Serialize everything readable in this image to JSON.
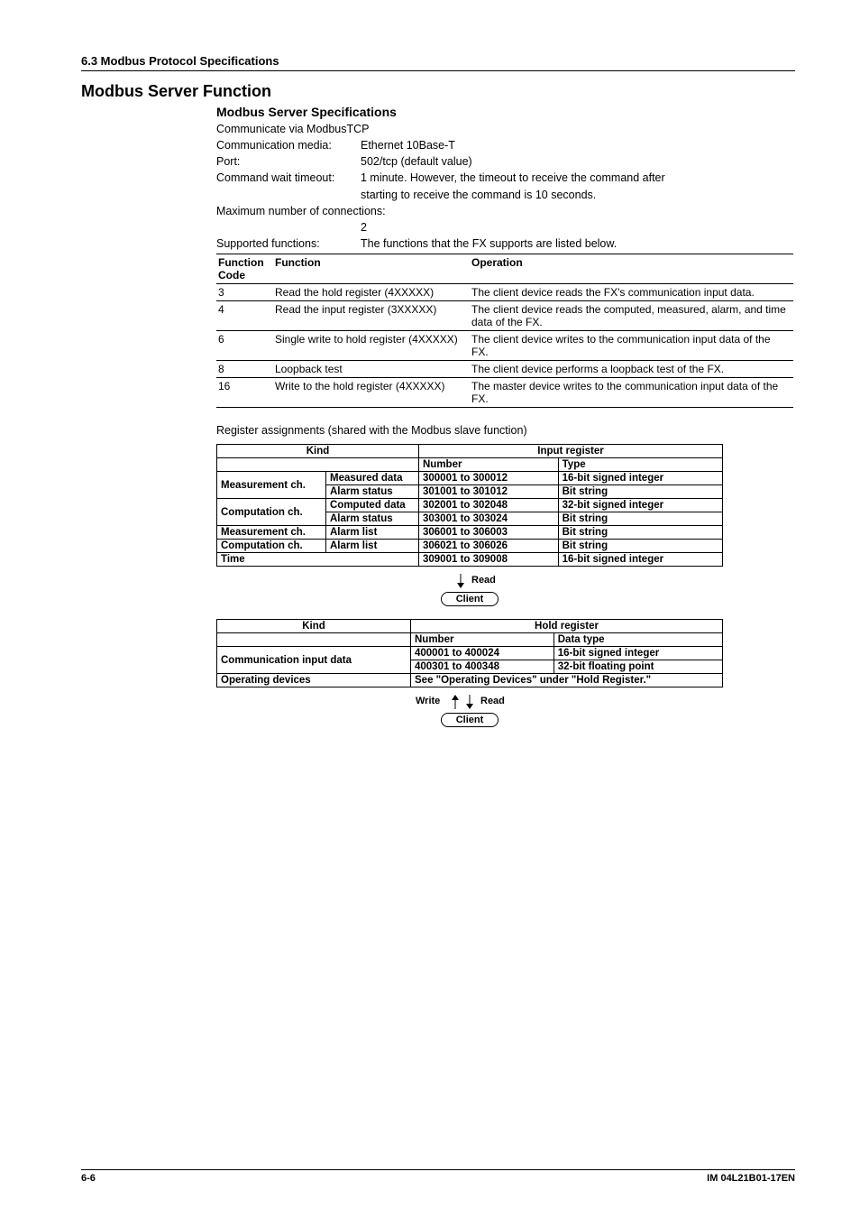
{
  "breadcrumb": "6.3  Modbus Protocol Specifications",
  "h2": "Modbus Server Function",
  "h3_specs": "Modbus Server Specifications",
  "comm_via": "Communicate via ModbusTCP",
  "specs": {
    "comm_media_label": "Communication media:",
    "comm_media_value": "Ethernet 10Base-T",
    "port_label": "Port:",
    "port_value": "502/tcp (default value)",
    "wait_label": "Command wait timeout:",
    "wait_value_1": "1 minute. However, the timeout to receive the command after",
    "wait_value_2": "starting to receive the command is 10 seconds.",
    "maxcon_label": "Maximum number of connections:",
    "maxcon_value": "2",
    "supp_label": "Supported functions:",
    "supp_value": "The functions that the FX supports are listed below."
  },
  "func_table": {
    "headers": {
      "code": "Function Code",
      "fn": "Function",
      "op": "Operation"
    },
    "rows": [
      {
        "code": "3",
        "fn": "Read the hold register (4XXXXX)",
        "op": "The client device reads the FX's communication input data."
      },
      {
        "code": "4",
        "fn": "Read the input register (3XXXXX)",
        "op": "The client device reads the computed, measured, alarm, and time data of the FX."
      },
      {
        "code": "6",
        "fn": "Single write to hold register (4XXXXX)",
        "op": "The client device writes to the communication input data of the FX."
      },
      {
        "code": "8",
        "fn": "Loopback test",
        "op": "The client device performs a loopback test of the FX."
      },
      {
        "code": "16",
        "fn": "Write to the hold register (4XXXXX)",
        "op": "The master device writes to the communication input data of the FX."
      }
    ]
  },
  "register_note": "Register assignments (shared with the Modbus slave function)",
  "chart_data": [
    {
      "type": "table",
      "title": "Input register",
      "columns": [
        "Kind (group)",
        "Kind (sub)",
        "Number",
        "Type"
      ],
      "rows": [
        [
          "Measurement ch.",
          "Measured data",
          "300001 to 300012",
          "16-bit signed integer"
        ],
        [
          "Measurement ch.",
          "Alarm status",
          "301001 to 301012",
          "Bit string"
        ],
        [
          "Computation ch.",
          "Computed data",
          "302001 to 302048",
          "32-bit signed integer"
        ],
        [
          "Computation ch.",
          "Alarm status",
          "303001 to 303024",
          "Bit string"
        ],
        [
          "Measurement ch.",
          "Alarm list",
          "306001 to 306003",
          "Bit string"
        ],
        [
          "Computation ch.",
          "Alarm list",
          "306021 to 306026",
          "Bit string"
        ],
        [
          "Time",
          "",
          "309001 to 309008",
          "16-bit signed integer"
        ]
      ]
    },
    {
      "type": "table",
      "title": "Hold register",
      "columns": [
        "Kind",
        "Number",
        "Data type"
      ],
      "rows": [
        [
          "Communication input data",
          "400001 to 400024",
          "16-bit signed integer"
        ],
        [
          "Communication input data",
          "400301 to 400348",
          "32-bit floating point"
        ],
        [
          "Operating devices",
          "See \"Operating Devices\" under \"Hold Register.\"",
          ""
        ]
      ]
    }
  ],
  "input_reg": {
    "kind_header": "Kind",
    "ir_header": "Input register",
    "num_header": "Number",
    "type_header": "Type",
    "rows": [
      {
        "k1": "Measurement ch.",
        "k2": "Measured data",
        "num": "300001 to 300012",
        "type": "16-bit signed integer",
        "first_of_group": true
      },
      {
        "k1": "",
        "k2": "Alarm status",
        "num": "301001 to 301012",
        "type": "Bit string"
      },
      {
        "k1": "Computation ch.",
        "k2": "Computed data",
        "num": "302001 to 302048",
        "type": "32-bit signed integer",
        "first_of_group": true
      },
      {
        "k1": "",
        "k2": "Alarm status",
        "num": "303001 to 303024",
        "type": "Bit string"
      },
      {
        "k1": "Measurement ch.",
        "k2": "Alarm list",
        "num": "306001 to 306003",
        "type": "Bit string",
        "single": true
      },
      {
        "k1": "Computation ch.",
        "k2": "Alarm list",
        "num": "306021 to 306026",
        "type": "Bit string",
        "single": true
      },
      {
        "k1_span": "Time",
        "num": "309001 to 309008",
        "type": "16-bit signed integer",
        "full": true
      }
    ]
  },
  "hold_reg": {
    "kind_header": "Kind",
    "hr_header": "Hold register",
    "num_header": "Number",
    "dt_header": "Data type",
    "rows": [
      {
        "k": "Communication input data",
        "num": "400001 to 400024",
        "dt": "16-bit signed integer",
        "k_rowspan": 2
      },
      {
        "num": "400301 to 400348",
        "dt": "32-bit floating point"
      },
      {
        "k": "Operating devices",
        "merged": "See \"Operating Devices\" under \"Hold Register.\""
      }
    ]
  },
  "labels": {
    "read": "Read",
    "write": "Write",
    "client": "Client"
  },
  "footer": {
    "left": "6-6",
    "right": "IM 04L21B01-17EN"
  }
}
